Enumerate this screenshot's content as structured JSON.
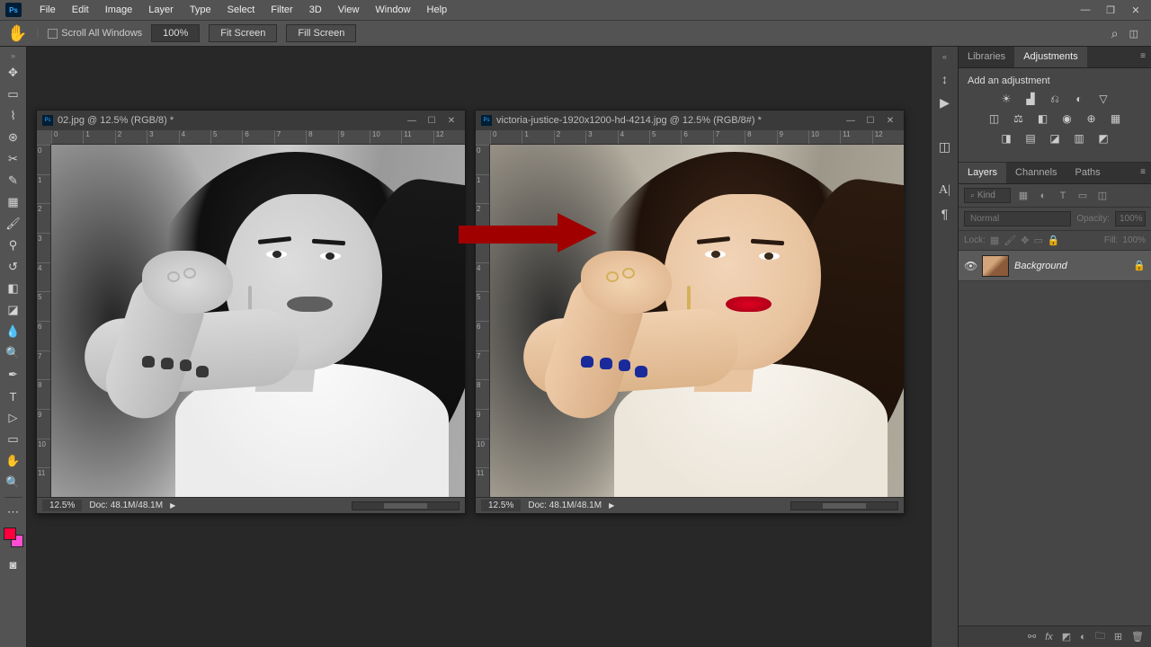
{
  "menu": {
    "items": [
      "File",
      "Edit",
      "Image",
      "Layer",
      "Type",
      "Select",
      "Filter",
      "3D",
      "View",
      "Window",
      "Help"
    ],
    "ps": "Ps"
  },
  "optbar": {
    "scroll_all": "Scroll All Windows",
    "zoom": "100%",
    "fit": "Fit Screen",
    "fill": "Fill Screen"
  },
  "doc1": {
    "title": "02.jpg @ 12.5% (RGB/8) *",
    "zoom": "12.5%",
    "status": "Doc: 48.1M/48.1M"
  },
  "doc2": {
    "title": "victoria-justice-1920x1200-hd-4214.jpg @ 12.5% (RGB/8#) *",
    "zoom": "12.5%",
    "status": "Doc: 48.1M/48.1M"
  },
  "ruler_h": [
    "0",
    "1",
    "2",
    "3",
    "4",
    "5",
    "6",
    "7",
    "8",
    "9",
    "10",
    "11",
    "12"
  ],
  "ruler_v": [
    "0",
    "1",
    "2",
    "3",
    "4",
    "5",
    "6",
    "7",
    "8",
    "9",
    "10",
    "11"
  ],
  "panels": {
    "lib_tab": "Libraries",
    "adj_tab": "Adjustments",
    "adj_header": "Add an adjustment",
    "layers_tab": "Layers",
    "channels_tab": "Channels",
    "paths_tab": "Paths",
    "kind": "Kind",
    "blend": "Normal",
    "opacity_lbl": "Opacity:",
    "opacity_val": "100%",
    "lock_lbl": "Lock:",
    "fill_lbl": "Fill:",
    "fill_val": "100%",
    "layer_name": "Background"
  }
}
